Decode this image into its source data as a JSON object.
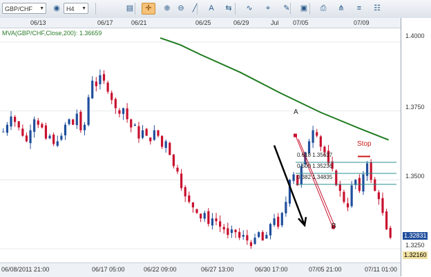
{
  "toolbar": {
    "symbol": "GBP/CHF",
    "timeframe": "H4",
    "buttons": [
      {
        "name": "dropdown-icon",
        "glyph": "▾"
      },
      {
        "name": "globe-icon",
        "glyph": "◉"
      },
      {
        "name": "dropdown-icon",
        "glyph": "▾"
      },
      {
        "name": "bar-chart-icon",
        "glyph": "▤"
      },
      {
        "name": "crosshair-icon",
        "glyph": "✛",
        "active": true
      },
      {
        "name": "zoom-in-icon",
        "glyph": "⊕"
      },
      {
        "name": "zoom-out-icon",
        "glyph": "⊖"
      },
      {
        "name": "line-tool-icon",
        "glyph": "╱"
      },
      {
        "name": "text-tool-icon",
        "glyph": "A"
      },
      {
        "name": "scroll-icon",
        "glyph": "⇆"
      },
      {
        "name": "indicator-icon",
        "glyph": "∿"
      },
      {
        "name": "pin-icon",
        "glyph": "⌖"
      },
      {
        "name": "pencil-icon",
        "glyph": "✎"
      },
      {
        "name": "image-icon",
        "glyph": "▣"
      },
      {
        "name": "print-icon",
        "glyph": "⎙"
      },
      {
        "name": "fork-icon",
        "glyph": "⋔"
      },
      {
        "name": "fib-icon",
        "glyph": "≡"
      },
      {
        "name": "properties-icon",
        "glyph": "☷"
      }
    ]
  },
  "top_dates": [
    "06/13",
    "06/17",
    "06/21",
    "06/25",
    "06/29",
    "Jul",
    "07/05",
    "07/09"
  ],
  "bottom_dates": [
    "06/08/2011 21:00",
    "06/17 05:00",
    "06/22 09:00",
    "06/27 13:00",
    "06/30 17:00",
    "07/05 21:00",
    "07/11 01:00"
  ],
  "price_ticks": [
    "1.4000",
    "1.3750",
    "1.3500",
    "1.3250"
  ],
  "current_prices": {
    "bid": "1.32831",
    "ask": "1.32160"
  },
  "indicator": {
    "label": "MVA(GBP/CHF,Close,200): 1.36659"
  },
  "fib": [
    {
      "label": "0.618 1.35637"
    },
    {
      "label": "0.500 1.35236"
    },
    {
      "label": "0.382 1.34835"
    }
  ],
  "points": {
    "a": "A",
    "b": "B",
    "stop": "Stop"
  },
  "colors": {
    "up": "#1f4e9c",
    "down": "#c8102e",
    "mva": "#1f7a1f",
    "fib": "#2a8c8c",
    "trend": "#000000"
  },
  "chart_data": {
    "type": "candlestick",
    "symbol": "GBP/CHF",
    "timeframe": "H4",
    "ylim": [
      1.32,
      1.405
    ],
    "mva_200": [
      {
        "x": 0.4,
        "y": 1.4015
      },
      {
        "x": 0.45,
        "y": 1.399
      },
      {
        "x": 0.5,
        "y": 1.3955
      },
      {
        "x": 0.6,
        "y": 1.389
      },
      {
        "x": 0.7,
        "y": 1.3815
      },
      {
        "x": 0.8,
        "y": 1.3745
      },
      {
        "x": 0.9,
        "y": 1.3685
      },
      {
        "x": 0.97,
        "y": 1.3645
      }
    ],
    "ohlc_path": [
      1.3675,
      1.37,
      1.373,
      1.371,
      1.369,
      1.366,
      1.364,
      1.368,
      1.372,
      1.37,
      1.369,
      1.365,
      1.366,
      1.363,
      1.364,
      1.366,
      1.37,
      1.372,
      1.37,
      1.374,
      1.368,
      1.37,
      1.38,
      1.386,
      1.384,
      1.388,
      1.386,
      1.382,
      1.379,
      1.376,
      1.374,
      1.376,
      1.372,
      1.369,
      1.37,
      1.365,
      1.368,
      1.366,
      1.364,
      1.368,
      1.366,
      1.362,
      1.364,
      1.359,
      1.355,
      1.353,
      1.347,
      1.344,
      1.342,
      1.34,
      1.338,
      1.336,
      1.338,
      1.334,
      1.336,
      1.335,
      1.333,
      1.332,
      1.33,
      1.332,
      1.331,
      1.329,
      1.33,
      1.328,
      1.326,
      1.329,
      1.331,
      1.328,
      1.33,
      1.334,
      1.336,
      1.333,
      1.338,
      1.342,
      1.35,
      1.352,
      1.348,
      1.355,
      1.36,
      1.364,
      1.368,
      1.366,
      1.362,
      1.36,
      1.356,
      1.354,
      1.348,
      1.346,
      1.342,
      1.34,
      1.348,
      1.35,
      1.346,
      1.352,
      1.356,
      1.35,
      1.346,
      1.343,
      1.338,
      1.332,
      1.329
    ],
    "annotations": [
      {
        "label": "A",
        "price": 1.366
      },
      {
        "label": "B",
        "price": 1.334
      },
      {
        "label": "Stop",
        "price": 1.356
      }
    ]
  }
}
